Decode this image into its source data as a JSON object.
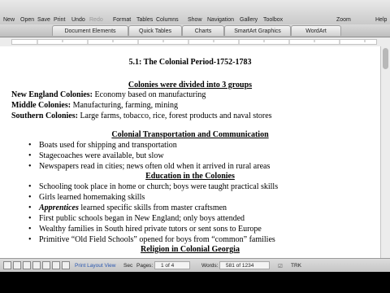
{
  "toolbar": {
    "items": [
      "New",
      "Open",
      "Save",
      "Print",
      "Undo",
      "Redo",
      "Format",
      "Tables",
      "Columns",
      "Show",
      "Navigation",
      "Gallery",
      "Toolbox",
      "Zoom",
      "Help"
    ]
  },
  "ribbon": {
    "tabs": [
      "Document Elements",
      "Quick Tables",
      "Charts",
      "SmartArt Graphics",
      "WordArt"
    ]
  },
  "document": {
    "title": "5.1: The Colonial Period-1752-1783",
    "heading1": "Colonies were divided into 3 groups",
    "colonies": [
      {
        "label": "New England Colonies:",
        "text": " Economy based on manufacturing"
      },
      {
        "label": "Middle Colonies:",
        "text": " Manufacturing, farming, mining"
      },
      {
        "label": "Southern Colonies:",
        "text": " Large farms, tobacco, rice, forest products and naval stores"
      }
    ],
    "heading2": "Colonial Transportation and Communication",
    "transport_bullets": [
      "Boats used for shipping and transportation",
      "Stagecoaches were available, but slow",
      "Newspapers read in cities; news often old when it arrived in rural areas"
    ],
    "heading3": "Education in the Colonies",
    "education_bullets": [
      {
        "italic": "",
        "text": "Schooling took place in home or church; boys were taught practical skills"
      },
      {
        "italic": "",
        "text": "Girls learned homemaking skills"
      },
      {
        "italic": "Apprentices",
        "text": " learned specific skills from master craftsmen"
      },
      {
        "italic": "",
        "text": "First public schools began in New England; only boys attended"
      },
      {
        "italic": "",
        "text": "Wealthy families in South hired private tutors or sent sons to Europe"
      },
      {
        "italic": "",
        "text": "Primitive “Old Field Schools” opened for boys from “common” families"
      }
    ],
    "heading4": "Religion in Colonial Georgia"
  },
  "statusbar": {
    "view": "Print Layout View",
    "sec_label": "Sec",
    "pages_label": "Pages:",
    "pages_value": "1 of 4",
    "words_label": "Words:",
    "words_value": "581 of 1234",
    "trk": "TRK"
  }
}
